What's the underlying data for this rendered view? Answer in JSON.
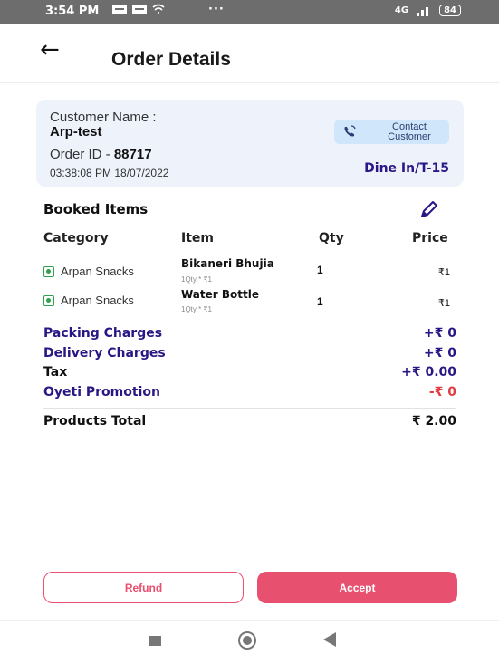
{
  "status_bar": {
    "time": "3:54 PM",
    "dots": "···",
    "network": "4G",
    "battery": "84"
  },
  "header": {
    "back_icon": "arrow-left-icon",
    "title": "Order Details"
  },
  "order_card": {
    "customer_label": "Customer Name :",
    "customer_name": "Arp-test",
    "order_id_label": "Order ID - ",
    "order_id": "88717",
    "timestamp": "03:38:08 PM 18/07/2022",
    "contact_button_line1": "Contact",
    "contact_button_line2": "Customer",
    "dine_info": "Dine In/T-15"
  },
  "booked_items": {
    "title": "Booked Items",
    "columns": [
      "Category",
      "Item",
      "Qty",
      "Price"
    ],
    "rows": [
      {
        "category": "Arpan Snacks",
        "item": "Bikaneri Bhujia",
        "sub": "1Qty * ₹1",
        "qty": "1",
        "price": "₹1"
      },
      {
        "category": "Arpan Snacks",
        "item": "Water Bottle",
        "sub": "1Qty * ₹1",
        "qty": "1",
        "price": "₹1"
      }
    ]
  },
  "summary": {
    "packing_label": "Packing Charges",
    "packing_value": "+₹ 0",
    "delivery_label": "Delivery Charges",
    "delivery_value": "+₹ 0",
    "tax_label": "Tax",
    "tax_value": "+₹ 0.00",
    "promotion_label": "Oyeti Promotion",
    "promotion_value": "-₹ 0",
    "total_label": "Products Total",
    "total_value": "₹ 2.00"
  },
  "actions": {
    "refund_label": "Refund",
    "accept_label": "Accept"
  },
  "colors": {
    "accent": "#e8506f",
    "navy": "#2a1785",
    "card_bg": "#eef2fb",
    "contact_bg": "#cfe6fb",
    "veg_green": "#2fa14e"
  }
}
